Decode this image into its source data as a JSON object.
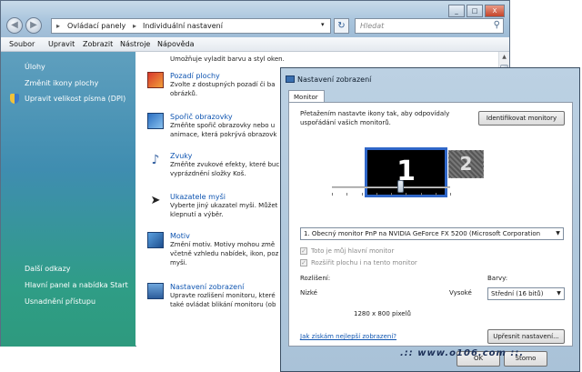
{
  "explorer": {
    "window_buttons": {
      "minimize": "_",
      "maximize": "□",
      "close": "X"
    },
    "nav": {
      "back_icon": "back-arrow-icon",
      "forward_icon": "forward-arrow-icon"
    },
    "address": {
      "segments": [
        "Ovládací panely",
        "Individuální nastavení"
      ],
      "separator": "▸"
    },
    "search_placeholder": "Hledat",
    "menu": [
      "Soubor",
      "Upravit",
      "Zobrazit",
      "Nástroje",
      "Nápověda"
    ],
    "sidebar_tasks": [
      "Úlohy",
      "Změnit ikony plochy",
      "Upravit velikost písma (DPI)"
    ],
    "sidebar_see_also": [
      "Další odkazy",
      "Hlavní panel a nabídka Start",
      "Usnadnění přístupu"
    ],
    "content_top_text": "Umožňuje vyladit barvu a styl oken.",
    "items": [
      {
        "title": "Pozadí plochy",
        "desc": [
          "Zvolte z dostupných pozadí či ba",
          "obrázků."
        ],
        "icon": "desktop-background-icon"
      },
      {
        "title": "Spořič obrazovky",
        "desc": [
          "Změňte spořič obrazovky nebo u",
          "animace, která pokrývá obrazovk"
        ],
        "icon": "screensaver-icon"
      },
      {
        "title": "Zvuky",
        "desc": [
          "Změňte zvukové efekty, které buc",
          "vyprázdnění složky Koš."
        ],
        "icon": "sound-icon"
      },
      {
        "title": "Ukazatele myši",
        "desc": [
          "Vyberte jiný ukazatel myši. Můžet",
          "klepnutí a výběr."
        ],
        "icon": "mouse-pointer-icon"
      },
      {
        "title": "Motiv",
        "desc": [
          "Změní motiv. Motivy mohou změ",
          "včetně vzhledu nabídek, ikon, poz",
          "myši."
        ],
        "icon": "theme-icon"
      },
      {
        "title": "Nastavení zobrazení",
        "desc": [
          "Upravte rozlišení monitoru, které",
          "také ovládat blikání monitoru (ob"
        ],
        "icon": "display-settings-icon"
      }
    ]
  },
  "dialog": {
    "title": "Nastavení zobrazení",
    "tab": "Monitor",
    "instruction": [
      "Přetažením nastavte ikony tak, aby odpovídaly",
      "uspořádání vašich monitorů."
    ],
    "identify_button": "Identifikovat monitory",
    "monitor1_label": "1",
    "monitor2_label": "2",
    "monitor_select": "1. Obecný monitor PnP na NVIDIA GeForce FX 5200 (Microsoft Corporation",
    "primary_checkbox": "Toto je můj hlavní monitor",
    "extend_checkbox": "Rozšířit plochu i na tento monitor",
    "resolution_label": "Rozlišení:",
    "low_label": "Nízké",
    "high_label": "Vysoké",
    "resolution_value": "1280 x 800 pixelů",
    "resolution_slider_level": 0.58,
    "colors_label": "Barvy:",
    "colors_select": "Střední (16 bitů)",
    "help_link": "Jak získám nejlepší zobrazení?",
    "advanced_button": "Upřesnit nastavení...",
    "ok_button": "OK",
    "cancel_button": "Storno"
  },
  "watermark": ".:: www.o106.com ::."
}
